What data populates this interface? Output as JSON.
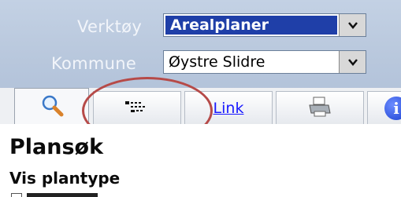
{
  "tool_row": {
    "label": "Verktøy",
    "value": "Arealplaner"
  },
  "municipality_row": {
    "label": "Kommune",
    "value": "Øystre Slidre"
  },
  "tabs": {
    "search_icon": "magnifier-icon",
    "legend_icon": "legend-list-icon",
    "link_label": "Link",
    "print_icon": "printer-icon",
    "info_icon": "info-icon",
    "info_glyph": "i"
  },
  "content": {
    "title": "Plansøk",
    "subtitle": "Vis plantype"
  },
  "colors": {
    "header_bg": "#b9c8dd",
    "selected_bg": "#1f3fa8",
    "link": "#1a1aff",
    "annotation": "#b64a48"
  }
}
